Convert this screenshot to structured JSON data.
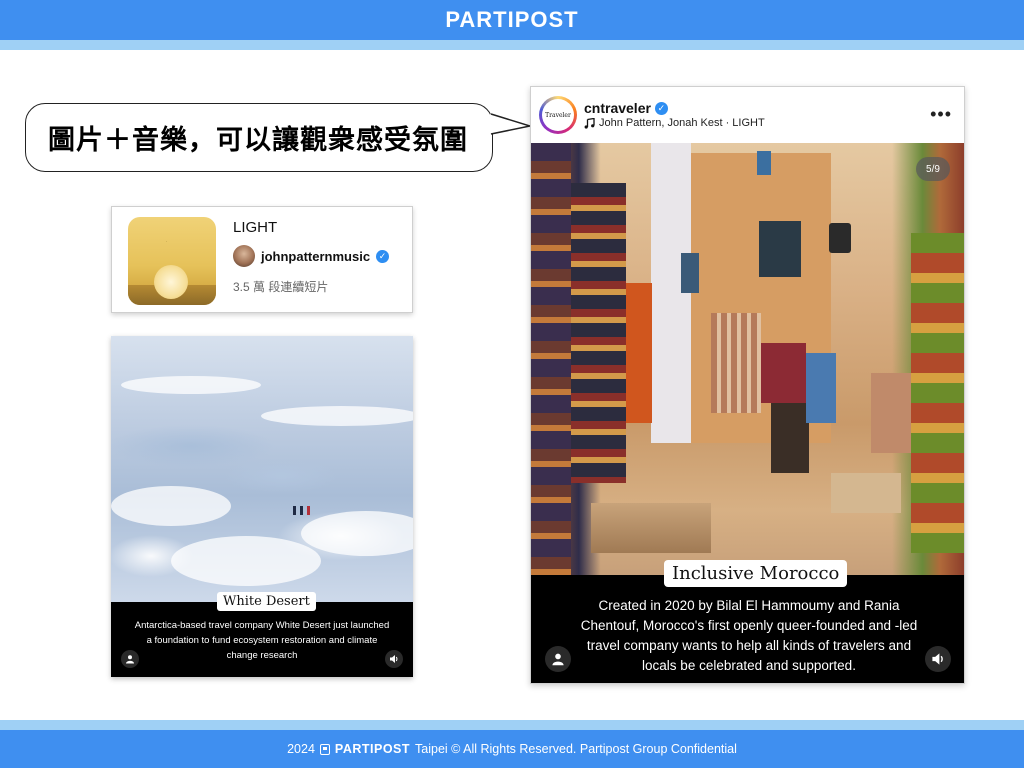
{
  "header": {
    "brand": "PARTIPOST"
  },
  "footer": {
    "year": "2024",
    "brand": "PARTIPOST",
    "text": "Taipei © All Rights Reserved. Partipost Group Confidential"
  },
  "callout": {
    "text": "圖片＋音樂，可以讓觀衆感受氛圍"
  },
  "music_card": {
    "title": "LIGHT",
    "artist": "johnpatternmusic",
    "stats": "3.5 萬 段連續短片"
  },
  "reel_left": {
    "tag": "White Desert",
    "description": "Antarctica-based travel company White Desert just launched a foundation to fund ecosystem restoration and climate change research"
  },
  "reel_right": {
    "username": "cntraveler",
    "song": "John Pattern, Jonah Kest · LIGHT",
    "avatar_text": "Traveler",
    "counter": "5/9",
    "tag": "Inclusive Morocco",
    "description": "Created in 2020 by Bilal El Hammoumy and Rania Chentouf, Morocco's first openly queer-founded and -led travel company wants to help all kinds of travelers and locals be celebrated and supported."
  },
  "colors": {
    "brand_blue": "#3f8ff0",
    "stripe_light": "#9fd0f5",
    "verified": "#2e8ef2"
  }
}
